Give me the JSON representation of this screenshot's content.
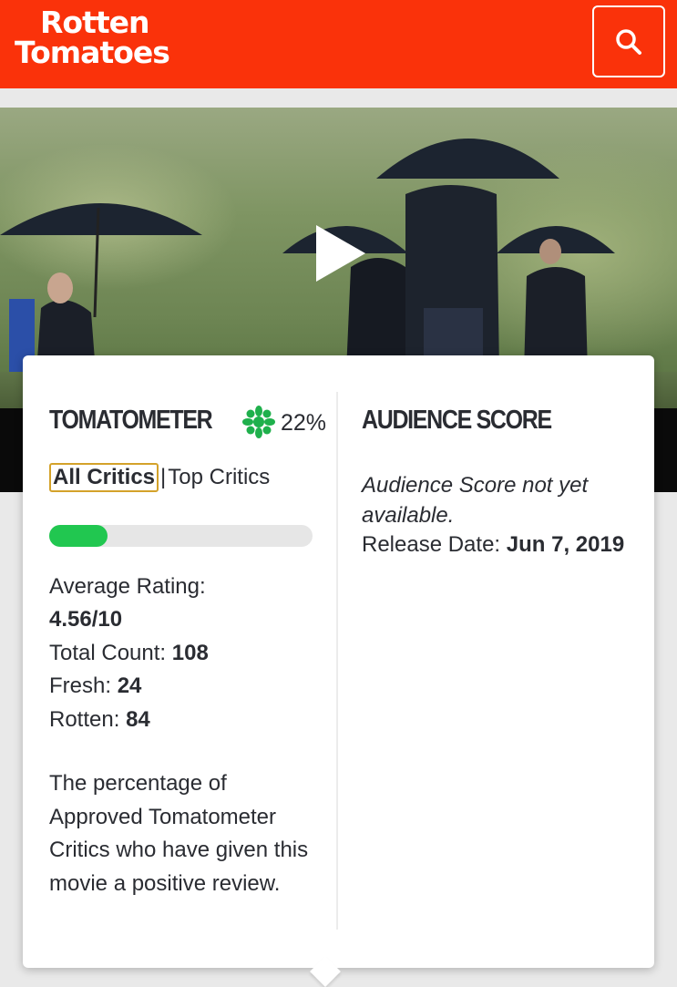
{
  "header": {
    "logo_line1": "Rotten",
    "logo_line2": "Tomatoes",
    "brand_color": "#fa320a"
  },
  "hero": {
    "play_icon": "play-icon"
  },
  "tomatometer": {
    "title": "TOMATOMETER",
    "icon": "green-splat-icon",
    "score": "22%",
    "tabs": {
      "all_critics": "All Critics",
      "separator": "|",
      "top_critics": "Top Critics"
    },
    "fresh_fraction": 0.22,
    "avg_rating_label": "Average Rating:",
    "avg_rating_value": "4.56/10",
    "total_count_label": "Total Count:",
    "total_count_value": "108",
    "fresh_label": "Fresh:",
    "fresh_value": "24",
    "rotten_label": "Rotten:",
    "rotten_value": "84",
    "description": "The percentage of Approved Tomatometer Critics who have given this movie a positive review."
  },
  "audience": {
    "title": "AUDIENCE SCORE",
    "not_available": "Audience Score not yet available.",
    "release_label": "Release Date:",
    "release_value": "Jun 7, 2019"
  }
}
